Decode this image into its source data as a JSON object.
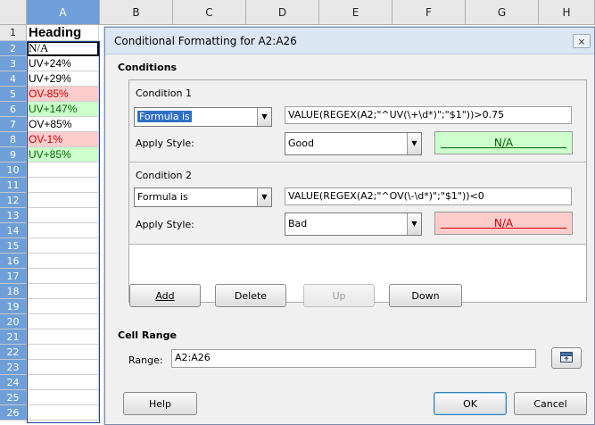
{
  "sheet": {
    "columns": [
      "A",
      "B",
      "C",
      "D",
      "E",
      "F",
      "G",
      "H"
    ],
    "rows": [
      "1",
      "2",
      "3",
      "4",
      "5",
      "6",
      "7",
      "8",
      "9",
      "10",
      "11",
      "12",
      "13",
      "14",
      "15",
      "16",
      "17",
      "18",
      "19",
      "20",
      "21",
      "22",
      "23",
      "24",
      "25",
      "26"
    ],
    "cells": [
      "Heading",
      "N/A",
      "UV+24%",
      "UV+29%",
      "OV-85%",
      "UV+147%",
      "OV+85%",
      "OV-1%",
      "UV+85%"
    ]
  },
  "dialog": {
    "title": "Conditional Formatting for A2:A26",
    "close_icon": "×",
    "conditions_label": "Conditions",
    "condition1": {
      "title": "Condition 1",
      "type": "Formula is",
      "formula": "VALUE(REGEX(A2;\"^UV(\\+\\d*)\";\"$1\"))>0.75",
      "apply_style_label": "Apply Style:",
      "style": "Good",
      "preview": "N/A"
    },
    "condition2": {
      "title": "Condition 2",
      "type": "Formula is",
      "formula": "VALUE(REGEX(A2;\"^OV(\\-\\d*)\";\"$1\"))<0",
      "apply_style_label": "Apply Style:",
      "style": "Bad",
      "preview": "N/A"
    },
    "buttons": {
      "add": "Add",
      "delete": "Delete",
      "up": "Up",
      "down": "Down",
      "help": "Help",
      "ok": "OK",
      "cancel": "Cancel"
    },
    "cell_range_label": "Cell Range",
    "range_label": "Range:",
    "range_value": "A2:A26"
  },
  "colors": {
    "good_bg": "#ccffcc",
    "good_fg": "#006600",
    "bad_bg": "#ffcccc",
    "bad_fg": "#cc0000",
    "selection": "#6e9fd8"
  }
}
